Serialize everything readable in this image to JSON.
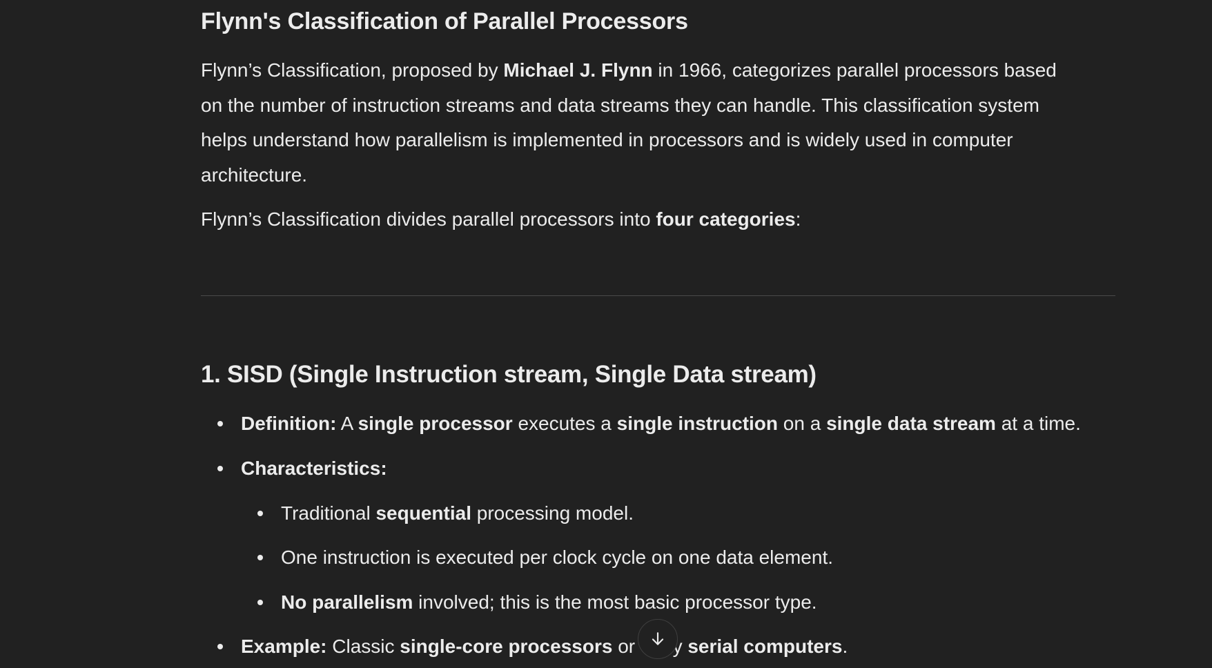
{
  "article": {
    "title": "Flynn's Classification of Parallel Processors",
    "intro": {
      "line1_pre": "Flynn’s Classification, proposed by ",
      "line1_bold": "Michael J. Flynn",
      "line1_post": " in 1966, categorizes parallel processors based",
      "line2": "on the number of instruction streams and data streams they can handle. This classification system",
      "line3": "helps understand how parallelism is implemented in processors and is widely used in computer",
      "line4": "architecture."
    },
    "categories_sentence": {
      "pre": "Flynn’s Classification divides parallel processors into ",
      "bold": "four categories",
      "post": ":"
    }
  },
  "sisd": {
    "heading": "1. SISD (Single Instruction stream, Single Data stream)",
    "definition": {
      "label": "Definition:",
      "t1": " A ",
      "b1": "single processor",
      "t2": " executes a ",
      "b2": "single instruction",
      "t3": " on a ",
      "b3": "single data stream",
      "t4": " at a time."
    },
    "characteristics_label": "Characteristics:",
    "characteristics": {
      "c1_pre": "Traditional ",
      "c1_bold": "sequential",
      "c1_post": " processing model.",
      "c2": "One instruction is executed per clock cycle on one data element.",
      "c3_bold": "No parallelism",
      "c3_post": " involved; this is the most basic processor type."
    },
    "example": {
      "label": "Example:",
      "t1": " Classic ",
      "b1": "single-core processors",
      "t2": " or early ",
      "b2": "serial computers",
      "t3": "."
    }
  },
  "ui": {
    "scroll_down_icon": "arrow-down-icon"
  }
}
